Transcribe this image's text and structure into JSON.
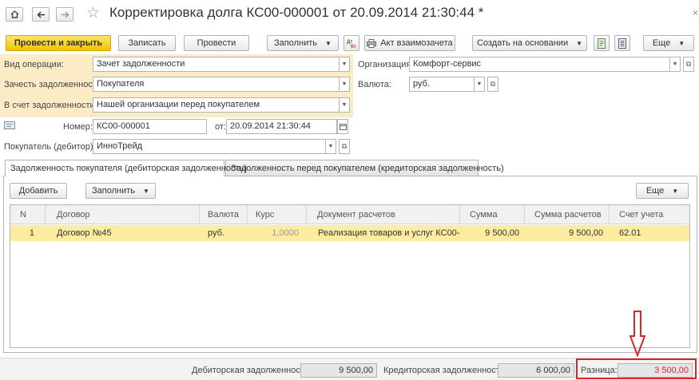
{
  "window": {
    "title": "Корректировка долга КС00-000001 от 20.09.2014 21:30:44 *"
  },
  "nav": {
    "home_icon": "home-icon",
    "back_icon": "arrow-left-icon",
    "forward_icon": "arrow-right-icon",
    "favorite_icon": "star-icon",
    "close_icon": "close-icon"
  },
  "toolbar": {
    "post_and_close": "Провести и закрыть",
    "save": "Записать",
    "post": "Провести",
    "fill": "Заполнить",
    "act": "Акт взаимозачета",
    "create_based_on": "Создать на основании",
    "more": "Еще"
  },
  "form": {
    "operation_label": "Вид операции:",
    "operation_value": "Зачет задолженности",
    "offset_debt_label": "Зачесть задолженность:",
    "offset_debt_value": "Покупателя",
    "against_debt_label": "В счет задолженности:",
    "against_debt_value": "Нашей организации перед покупателем",
    "organization_label": "Организация:",
    "organization_value": "Комфорт-сервис",
    "currency_label": "Валюта:",
    "currency_value": "руб.",
    "number_label": "Номер:",
    "number_value": "КС00-000001",
    "date_label": "от:",
    "date_value": "20.09.2014 21:30:44",
    "buyer_label": "Покупатель (дебитор):",
    "buyer_value": "ИнноТрейд"
  },
  "tabs": [
    {
      "label": "Задолженность покупателя (дебиторская задолженность)",
      "active": true
    },
    {
      "label": "Задолженность перед покупателем (кредиторская задолженность)",
      "active": false
    }
  ],
  "table_toolbar": {
    "add": "Добавить",
    "fill": "Заполнить",
    "more": "Еще"
  },
  "table": {
    "columns": [
      "N",
      "Договор",
      "Валюта",
      "Курс",
      "Документ расчетов",
      "Сумма",
      "Сумма расчетов",
      "Счет учета"
    ],
    "rows": [
      [
        "1",
        "Договор №45",
        "руб.",
        "1,0000",
        "Реализация товаров и услуг КС00-...",
        "9 500,00",
        "9 500,00",
        "62.01"
      ]
    ]
  },
  "totals": {
    "debit_label": "Дебиторская задолженность:",
    "debit_value": "9 500,00",
    "credit_label": "Кредиторская задолженность:",
    "credit_value": "6 000,00",
    "diff_label": "Разница:",
    "diff_value": "3 500,00"
  },
  "colors": {
    "primary_button": "#f2c400",
    "highlight_block": "#fcecc6",
    "selected_row": "#fbeca2",
    "annotation_red": "#d9252a"
  }
}
